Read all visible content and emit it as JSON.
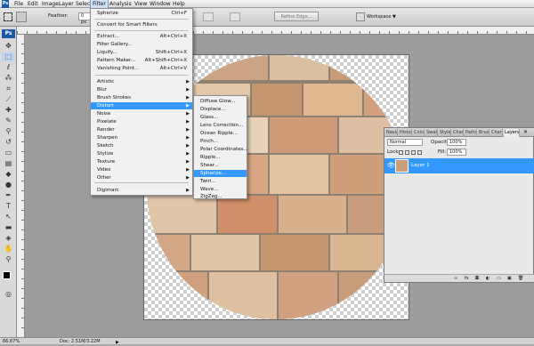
{
  "menubar": {
    "items": [
      "File",
      "Edit",
      "Image",
      "Layer",
      "Select",
      "Filter",
      "Analysis",
      "View",
      "Window",
      "Help"
    ]
  },
  "optbar": {
    "feather_label": "Feather:",
    "feather_value": "0 px",
    "refine_edge": "Refine Edge...",
    "workspace": "Workspace"
  },
  "filter_menu": {
    "items": [
      {
        "label": "Spherize",
        "shortcut": "Ctrl+F"
      },
      {
        "label": "Convert for Smart Filters",
        "shortcut": ""
      },
      {
        "label": "Extract...",
        "shortcut": "Alt+Ctrl+X"
      },
      {
        "label": "Filter Gallery...",
        "shortcut": ""
      },
      {
        "label": "Liquify...",
        "shortcut": "Shift+Ctrl+X"
      },
      {
        "label": "Pattern Maker...",
        "shortcut": "Alt+Shift+Ctrl+X"
      },
      {
        "label": "Vanishing Point...",
        "shortcut": "Alt+Ctrl+V"
      },
      {
        "label": "Artistic"
      },
      {
        "label": "Blur"
      },
      {
        "label": "Brush Strokes"
      },
      {
        "label": "Distort"
      },
      {
        "label": "Noise"
      },
      {
        "label": "Pixelate"
      },
      {
        "label": "Render"
      },
      {
        "label": "Sharpen"
      },
      {
        "label": "Sketch"
      },
      {
        "label": "Stylize"
      },
      {
        "label": "Texture"
      },
      {
        "label": "Video"
      },
      {
        "label": "Other"
      },
      {
        "label": "Digimarc"
      }
    ]
  },
  "distort_menu": {
    "items": [
      "Diffuse Glow...",
      "Displace...",
      "Glass...",
      "Lens Correction...",
      "Ocean Ripple...",
      "Pinch...",
      "Polar Coordinates...",
      "Ripple...",
      "Shear...",
      "Spherize...",
      "Twirl...",
      "Wave...",
      "ZigZag..."
    ]
  },
  "layers_panel": {
    "tabs": [
      "Navig",
      "Histo",
      "Colo",
      "Swat",
      "Style",
      "Char",
      "Paths",
      "Brus",
      "Chan",
      "Layers"
    ],
    "blend_mode": "Normal",
    "opacity_label": "Opacity:",
    "opacity_value": "100%",
    "lock_label": "Lock:",
    "fill_label": "Fill:",
    "fill_value": "100%",
    "layer_name": "Layer 1"
  },
  "statusbar": {
    "zoom": "66.67%",
    "doc": "Doc: 2.51M/3.22M"
  },
  "colors": {
    "selection": "#3399ff",
    "brick": "#c9a07a"
  }
}
